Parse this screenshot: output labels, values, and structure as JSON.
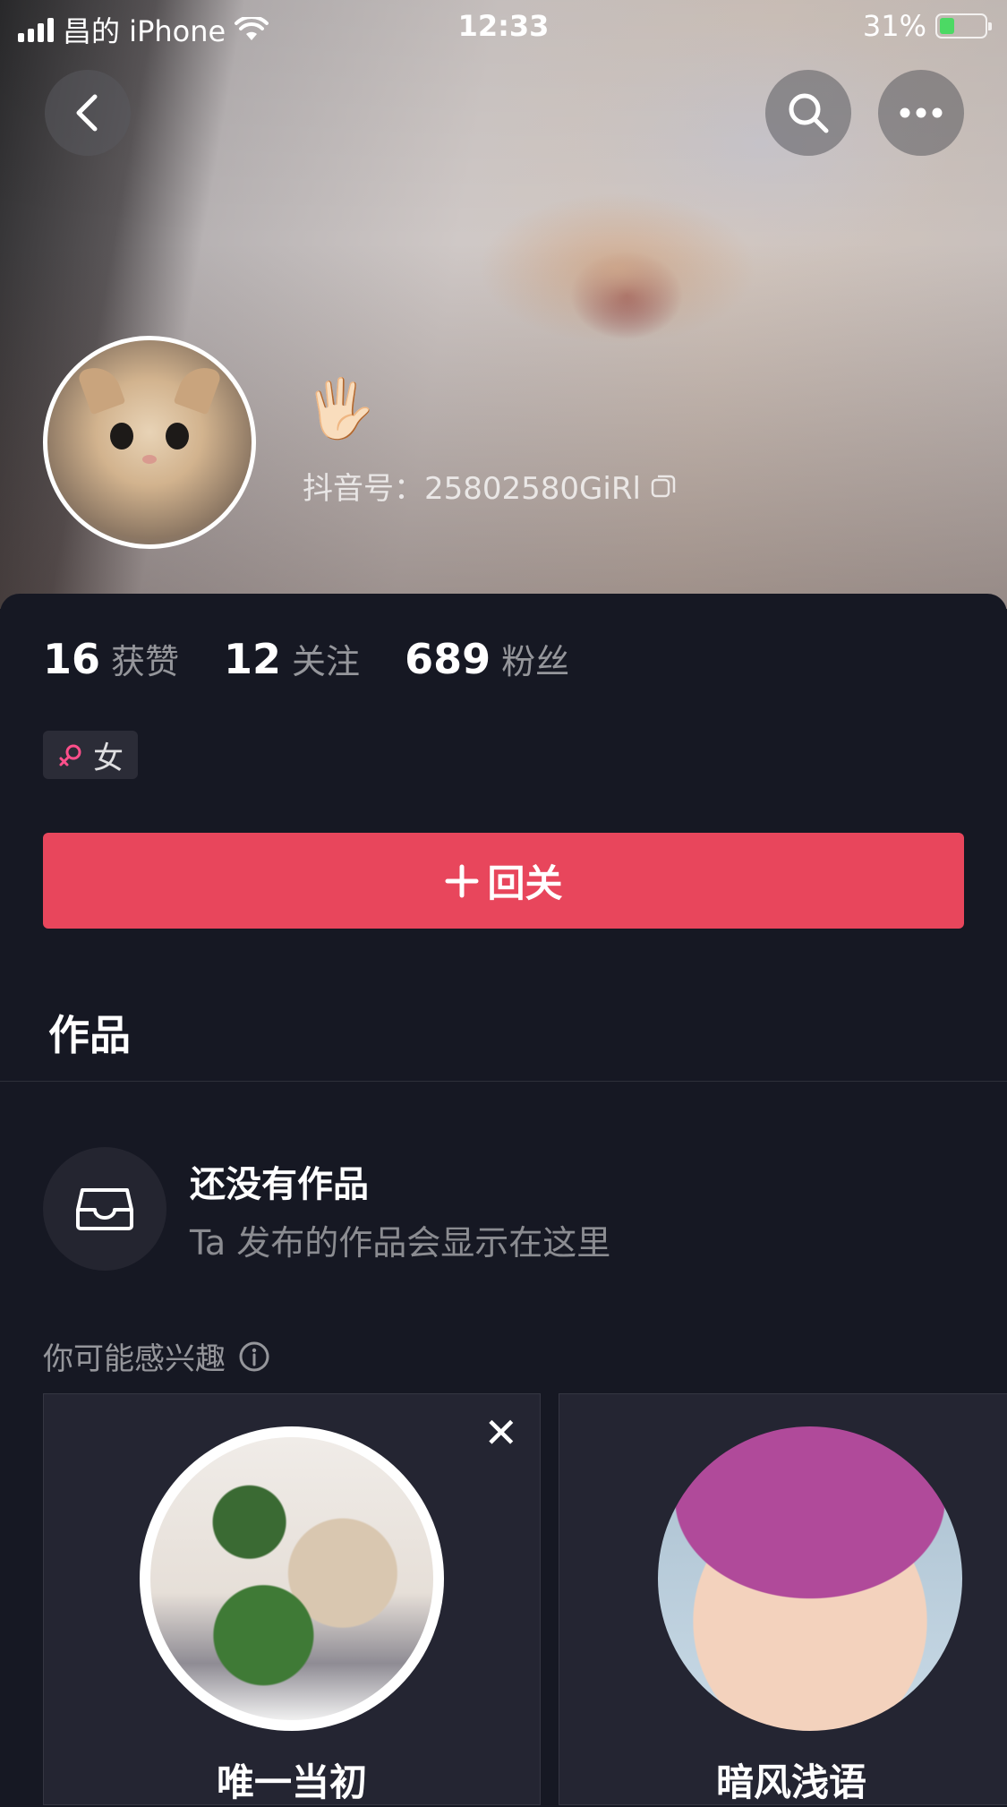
{
  "status_bar": {
    "carrier": "昌的 iPhone",
    "time": "12:33",
    "battery_percent": "31%",
    "battery_level": 0.31,
    "battery_color": "#4cd964"
  },
  "header": {
    "back_icon": "chevron-left-icon",
    "search_icon": "search-icon",
    "more_icon": "more-horizontal-icon"
  },
  "profile": {
    "nickname_emoji": "🖐🏻",
    "douyin_id": "抖音号：25802580GiRl",
    "copy_icon": "copy-icon",
    "stats": [
      {
        "value": "16",
        "label": "获赞"
      },
      {
        "value": "12",
        "label": "关注"
      },
      {
        "value": "689",
        "label": "粉丝"
      }
    ],
    "gender_label": "女",
    "gender_color": "#ff4f8b",
    "follow_button": "回关",
    "follow_button_color": "#e8465c"
  },
  "tabs": {
    "works": "作品"
  },
  "empty_state": {
    "title": "还没有作品",
    "subtitle": "Ta 发布的作品会显示在这里"
  },
  "suggestions": {
    "title": "你可能感兴趣",
    "cards": [
      {
        "name": "唯一当初"
      },
      {
        "name": "暗风浅语"
      }
    ]
  }
}
